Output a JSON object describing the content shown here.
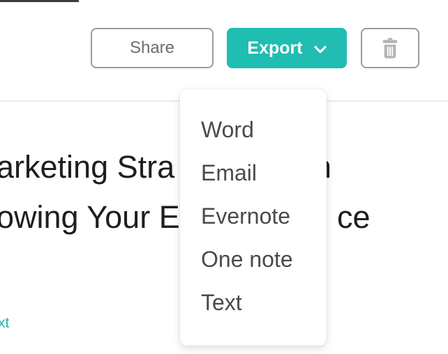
{
  "toolbar": {
    "share_label": "Share",
    "export_label": "Export"
  },
  "export_menu": {
    "items": [
      "Word",
      "Email",
      "Evernote",
      "One note",
      "Text"
    ]
  },
  "document": {
    "heading_line1_left": "arketing Stra",
    "heading_line1_right_fragment": "n",
    "heading_line2_left": "owing Your E",
    "heading_line2_right_fragment": "ce",
    "link_fragment": "xt"
  },
  "colors": {
    "accent_teal": "#1FBDB2",
    "button_border": "#9C9C9C",
    "share_text": "#6D6D6D",
    "menu_text": "#4A4A4A",
    "heading_text": "#1E1E1E",
    "trash_icon": "#B5B5B5",
    "divider": "#ECECEC",
    "link_teal": "#2BB5AB"
  }
}
